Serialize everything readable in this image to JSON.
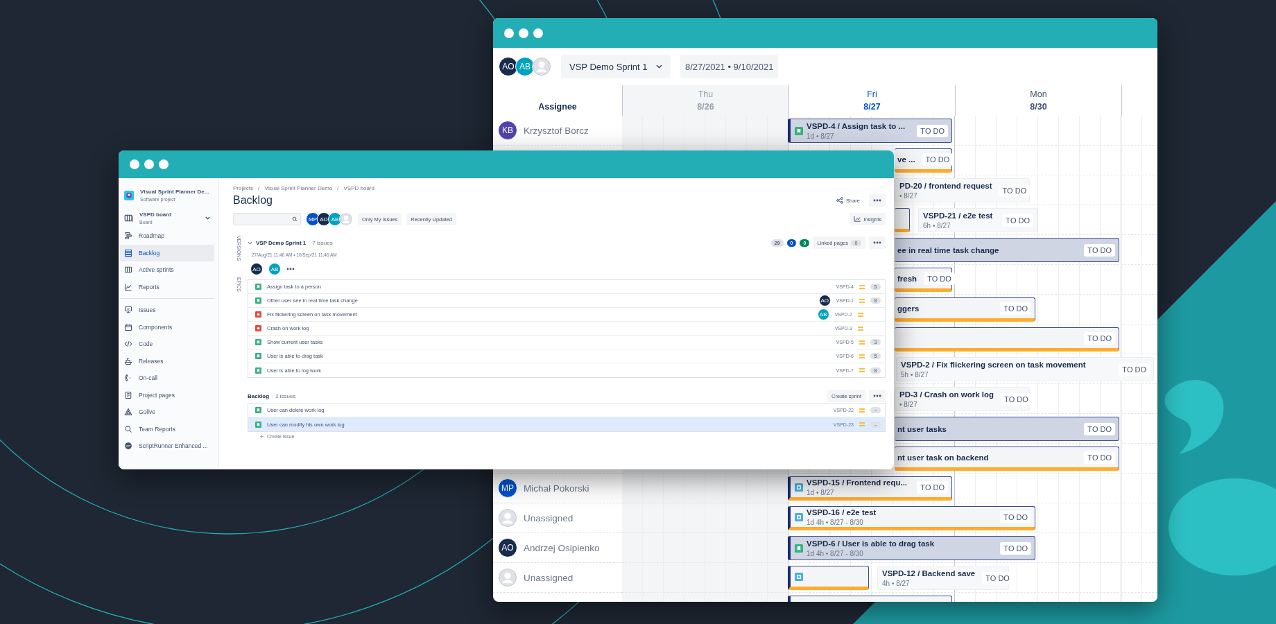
{
  "board_window": {
    "assignee_filter": [
      {
        "initials": "AO",
        "color": "#172b4d"
      },
      {
        "initials": "AB",
        "color": "#00a3bf"
      },
      {
        "kind": "unassigned"
      }
    ],
    "sprint_select": "VSP Demo Sprint 1",
    "date_range": "8/27/2021 • 9/10/2021",
    "assignee_heading": "Assignee",
    "days": [
      {
        "weekday": "Thu",
        "date": "8/26",
        "kind": "past"
      },
      {
        "weekday": "Fri",
        "date": "8/27",
        "kind": "today"
      },
      {
        "weekday": "Mon",
        "date": "8/30",
        "kind": "future"
      }
    ],
    "rows": [
      {
        "assignee": {
          "name": "Krzysztof Borcz",
          "initials": "KB",
          "color": "#5243aa"
        },
        "bars": [
          {
            "scheduled": true,
            "selected": true,
            "kind": "story",
            "title": "VSPD-4 / Assign task to ...",
            "meta": "1d • 8/27",
            "status": "TO DO"
          }
        ]
      },
      {
        "bars": [
          {
            "scheduled": true,
            "selected": false,
            "title": "ve ...",
            "status": "TO DO"
          }
        ]
      },
      {
        "bars": [
          {
            "scheduled": false,
            "selected": false,
            "title": "PD-20 / frontend request",
            "meta": "• 8/27",
            "status": "TO DO"
          }
        ]
      },
      {
        "bars": [
          {
            "scheduled": true,
            "selected": false
          },
          {
            "scheduled": false,
            "selected": false,
            "title": "VSPD-21 / e2e test",
            "meta": "6h • 8/27",
            "status": "TO DO"
          }
        ]
      },
      {
        "bars": [
          {
            "scheduled": true,
            "selected": true,
            "title": "ee in real time task change",
            "status": "TO DO"
          }
        ]
      },
      {
        "bars": [
          {
            "scheduled": true,
            "selected": false,
            "title": "fresh",
            "status": "TO DO"
          }
        ]
      },
      {
        "bars": [
          {
            "scheduled": true,
            "selected": false,
            "title": "ggers",
            "status": "TO DO"
          }
        ]
      },
      {
        "bars": [
          {
            "scheduled": true,
            "selected": false,
            "status": "TO DO"
          }
        ]
      },
      {
        "bars": [
          {
            "scheduled": false,
            "selected": false,
            "title": "VSPD-2 / Fix flickering screen on task movement",
            "meta": "5h • 8/27",
            "status": "TO DO"
          }
        ]
      },
      {
        "bars": [
          {
            "scheduled": false,
            "selected": false,
            "title": "PD-3 / Crash on work log",
            "meta": "• 8/27",
            "status": "TO DO"
          }
        ]
      },
      {
        "bars": [
          {
            "scheduled": true,
            "selected": true,
            "title": "nt user tasks",
            "status": "TO DO"
          }
        ]
      },
      {
        "bars": [
          {
            "scheduled": true,
            "selected": false,
            "title": "nt user task on backend",
            "status": "TO DO"
          }
        ]
      },
      {
        "assignee": {
          "name": "Michał Pokorski",
          "initials": "MP",
          "color": "#0052cc"
        },
        "bars": [
          {
            "scheduled": true,
            "selected": false,
            "kind": "task",
            "title": "VSPD-15 / Frontend requ...",
            "meta": "1d • 8/27",
            "status": "TO DO"
          }
        ]
      },
      {
        "assignee": {
          "name": "Unassigned",
          "kind": "unassigned"
        },
        "bars": [
          {
            "scheduled": true,
            "selected": false,
            "kind": "task",
            "title": "VSPD-16 / e2e test",
            "meta": "1d 4h • 8/27 - 8/30",
            "status": "TO DO"
          }
        ]
      },
      {
        "assignee": {
          "name": "Andrzej Osipienko",
          "initials": "AO",
          "color": "#172b4d"
        },
        "bars": [
          {
            "scheduled": true,
            "selected": true,
            "kind": "story",
            "title": "VSPD-6 / User is able to drag task",
            "meta": "1d 4h • 8/27 - 8/30",
            "status": "TO DO"
          }
        ]
      },
      {
        "assignee": {
          "name": "Unassigned",
          "kind": "unassigned"
        },
        "bars": [
          {
            "scheduled": true,
            "selected": false,
            "kind": "task"
          },
          {
            "scheduled": false,
            "selected": false,
            "title": "VSPD-12 / Backend save",
            "meta": "4h • 8/27",
            "status": "TO DO"
          }
        ]
      },
      {
        "bars": [
          {
            "scheduled": true,
            "selected": false
          }
        ]
      }
    ]
  },
  "backlog_window": {
    "project": {
      "name": "Visual Sprint Planner De...",
      "type": "Software project"
    },
    "board": {
      "name": "VSPD board",
      "type": "Board"
    },
    "nav_groups": [
      [
        {
          "label": "Roadmap",
          "selected": false
        },
        {
          "label": "Backlog",
          "selected": true
        },
        {
          "label": "Active sprints",
          "selected": false
        },
        {
          "label": "Reports",
          "selected": false
        }
      ],
      [
        {
          "label": "Issues",
          "selected": false
        },
        {
          "label": "Components",
          "selected": false
        },
        {
          "label": "Code",
          "selected": false
        },
        {
          "label": "Releases",
          "selected": false
        },
        {
          "label": "On-call",
          "selected": false
        },
        {
          "label": "Project pages",
          "selected": false
        },
        {
          "label": "Golive",
          "selected": false
        },
        {
          "label": "Team Reports",
          "selected": false
        },
        {
          "label": "ScriptRunner Enhanced ...",
          "selected": false
        }
      ]
    ],
    "breadcrumbs": [
      "Projects",
      "/",
      "Visual Sprint Planner Demo",
      "/",
      "VSPD board"
    ],
    "title": "Backlog",
    "share": "Share",
    "people": [
      {
        "initials": "MP",
        "color": "#0052cc"
      },
      {
        "initials": "AO",
        "color": "#172b4d"
      },
      {
        "initials": "AB",
        "color": "#00a3bf"
      },
      {
        "kind": "unassigned"
      }
    ],
    "filters": [
      "Only My Issues",
      "Recently Updated"
    ],
    "insights": "Insights",
    "side_tabs": [
      "VERSIONS",
      "EPICS"
    ],
    "sprint": {
      "name": "VSP Demo Sprint 1",
      "count": "7 issues",
      "expanded": true,
      "dates": "27/Aug/21 11:46 AM • 10/Sep/21 11:46 AM",
      "status_counts": [
        {
          "value": "29",
          "color": "#dfe1e6"
        },
        {
          "value": "0",
          "color": "#0052cc"
        },
        {
          "value": "0",
          "color": "#00875a"
        }
      ],
      "linked_pages": "Linked pages",
      "linked_count": "0",
      "assignees": [
        {
          "initials": "AO",
          "color": "#172b4d"
        },
        {
          "initials": "AB",
          "color": "#00a3bf"
        }
      ],
      "issues": [
        {
          "kind": "story",
          "summary": "Assign task to a person",
          "key": "VSPD-4",
          "estimate": "5",
          "selected": false
        },
        {
          "kind": "story",
          "summary": "Other user see in real time task change",
          "key": "VSPD-1",
          "estimate": "8",
          "assignee": {
            "initials": "AO",
            "color": "#172b4d"
          },
          "selected": false
        },
        {
          "kind": "bug",
          "summary": "Fix flickering screen on task movement",
          "key": "VSPD-2",
          "assignee": {
            "initials": "AB",
            "color": "#00a3bf"
          },
          "selected": false
        },
        {
          "kind": "bug",
          "summary": "Crash on work log",
          "key": "VSPD-3",
          "selected": false
        },
        {
          "kind": "story",
          "summary": "Show current user tasks",
          "key": "VSPD-5",
          "estimate": "3",
          "selected": false
        },
        {
          "kind": "story",
          "summary": "User is able to drag task",
          "key": "VSPD-6",
          "estimate": "5",
          "selected": false
        },
        {
          "kind": "story",
          "summary": "User is able to log work",
          "key": "VSPD-7",
          "estimate": "8",
          "selected": false
        }
      ]
    },
    "backlog": {
      "name": "Backlog",
      "count": "2 issues",
      "action": "Create sprint",
      "create": "Create issue",
      "issues": [
        {
          "kind": "story",
          "summary": "User can delete work log",
          "key": "VSPD-22",
          "estimate": "-",
          "selected": false
        },
        {
          "kind": "story",
          "summary": "User can modify his own work log",
          "key": "VSPD-23",
          "estimate": "-",
          "selected": true
        }
      ]
    }
  }
}
